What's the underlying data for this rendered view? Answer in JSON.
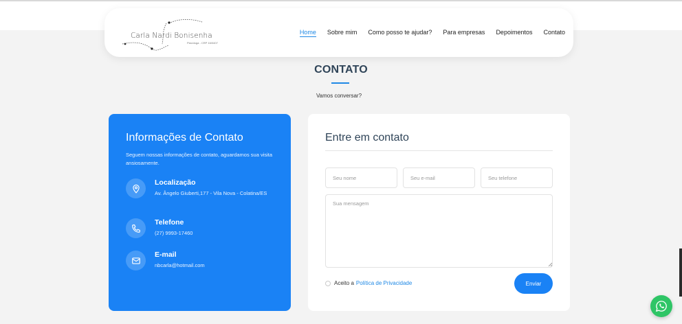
{
  "brand": {
    "name": "Carla Nardi Bonisenha",
    "subtitle": "Psicóloga - CRP 16/0407"
  },
  "nav": {
    "items": [
      "Home",
      "Sobre mim",
      "Como posso te ajudar?",
      "Para empresas",
      "Depoimentos",
      "Contato"
    ],
    "active": "Home"
  },
  "section": {
    "title": "CONTATO",
    "subtitle": "Vamos conversar?"
  },
  "info": {
    "title": "Informações de Contato",
    "intro": "Seguem nossas informações de contato, aguardamos sua visita ansiosamente.",
    "items": [
      {
        "icon": "location-pin-icon",
        "label": "Localização",
        "value": "Av. Ângelo Giuberti,177 - Vila Nova - Colatina/ES"
      },
      {
        "icon": "phone-icon",
        "label": "Telefone",
        "value": "(27) 9993-17460"
      },
      {
        "icon": "envelope-icon",
        "label": "E-mail",
        "value": "nbcarla@hotmail.com"
      }
    ]
  },
  "form": {
    "title": "Entre em contato",
    "name_placeholder": "Seu nome",
    "email_placeholder": "Seu e-mail",
    "phone_placeholder": "Seu telefone",
    "message_placeholder": "Sua mensagem",
    "consent_label": "Aceito a",
    "consent_link": "Política de Privacidade",
    "submit_label": "Enviar"
  },
  "colors": {
    "accent": "#1a82f5",
    "heading": "#2f4458",
    "whatsapp": "#2ec566",
    "background": "#f3f3f3"
  }
}
